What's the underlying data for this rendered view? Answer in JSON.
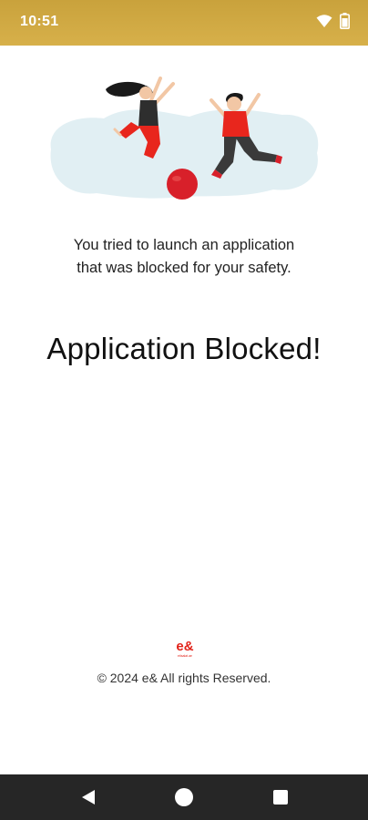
{
  "status_bar": {
    "time": "10:51",
    "icons": [
      "wifi-icon",
      "battery-icon"
    ]
  },
  "illustration": {
    "subject": "two-children-jumping-with-ball",
    "colors": {
      "blob": "#e1eff3",
      "ball": "#d8202a",
      "shirt": "#e8261d",
      "pants": "#3a3a3a"
    }
  },
  "message": {
    "line1": "You tried to launch an application",
    "line2": "that was blocked for your safety."
  },
  "title": "Application Blocked!",
  "footer": {
    "logo_text": "e&",
    "logo_subtext": "etisalat.ae",
    "copyright": "© 2024 e& All rights Reserved."
  },
  "nav_bar": {
    "buttons": [
      "back-icon",
      "home-icon",
      "recents-icon"
    ]
  },
  "colors": {
    "status_bar": "#cfa944",
    "brand_red": "#e2231a",
    "nav_bar": "#262626"
  }
}
